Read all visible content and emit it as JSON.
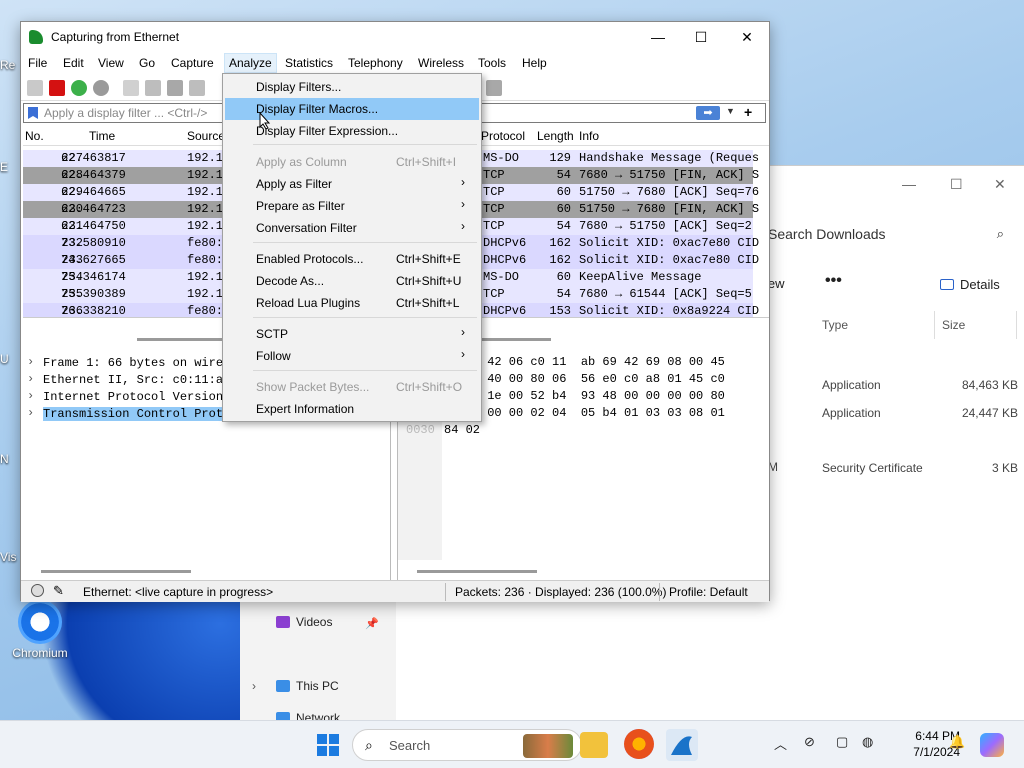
{
  "desktop": {
    "icon_chromium": "Chromium",
    "edge_fragments": [
      "Re",
      "E",
      "U",
      "N",
      "Vis"
    ]
  },
  "explorer": {
    "search_placeholder": "Search Downloads",
    "view_label": "iew",
    "more_label": "•••",
    "details_label": "Details",
    "col_type": "Type",
    "col_size": "Size",
    "rows": [
      {
        "type": "Application",
        "size": "84,463 KB"
      },
      {
        "type": "Application",
        "size": "24,447 KB"
      },
      {
        "type": "Security Certificate",
        "size": "3 KB"
      }
    ],
    "partial_m": "M",
    "nav": {
      "videos": "Videos",
      "this_pc": "This PC",
      "network": "Network"
    }
  },
  "wireshark": {
    "title": "Capturing from Ethernet",
    "menu": [
      "File",
      "Edit",
      "View",
      "Go",
      "Capture",
      "Analyze",
      "Statistics",
      "Telephony",
      "Wireless",
      "Tools",
      "Help"
    ],
    "filter_placeholder": "Apply a display filter ... <Ctrl-/>",
    "columns": {
      "no": "No.",
      "time": "Time",
      "source": "Source",
      "protocol": "Protocol",
      "length": "Length",
      "info": "Info"
    },
    "packets": [
      {
        "no": "227",
        "time": "62.463817",
        "src": "192.1",
        "proto": "MS-DO",
        "len": "129",
        "info": "Handshake Message (Reques"
      },
      {
        "no": "228",
        "time": "62.464379",
        "src": "192.1",
        "proto": "TCP",
        "len": "54",
        "info": "7680 → 51750 [FIN, ACK] S"
      },
      {
        "no": "229",
        "time": "62.464665",
        "src": "192.1",
        "proto": "TCP",
        "len": "60",
        "info": "51750 → 7680 [ACK] Seq=76"
      },
      {
        "no": "230",
        "time": "62.464723",
        "src": "192.1",
        "proto": "TCP",
        "len": "60",
        "info": "51750 → 7680 [FIN, ACK] S"
      },
      {
        "no": "231",
        "time": "62.464750",
        "src": "192.1",
        "proto": "TCP",
        "len": "54",
        "info": "7680 → 51750 [ACK] Seq=2"
      },
      {
        "no": "232",
        "time": "73.580910",
        "src": "fe80:",
        "proto": "DHCPv6",
        "len": "162",
        "info": "Solicit XID: 0xac7e80 CID"
      },
      {
        "no": "233",
        "time": "74.627665",
        "src": "fe80:",
        "proto": "DHCPv6",
        "len": "162",
        "info": "Solicit XID: 0xac7e80 CID"
      },
      {
        "no": "234",
        "time": "75.346174",
        "src": "192.1",
        "proto": "MS-DO",
        "len": "60",
        "info": "KeepAlive Message"
      },
      {
        "no": "235",
        "time": "75.390389",
        "src": "192.1",
        "proto": "TCP",
        "len": "54",
        "info": "7680 → 61544 [ACK] Seq=5"
      },
      {
        "no": "236",
        "time": "76.338210",
        "src": "fe80:",
        "proto": "DHCPv6",
        "len": "153",
        "info": "Solicit XID: 0x8a9224 CID"
      }
    ],
    "details": [
      "Frame 1: 66 bytes on wire",
      "Ethernet II, Src: c0:11:a",
      "Internet Protocol Version",
      "Transmission Control Prot"
    ],
    "hex": [
      "ab 69 42 06 c0 11  ab 69 42 69 08 00 45",
      "20 3e 40 00 80 06  56 e0 c0 a8 01 45 c0",
      "f0 97 1e 00 52 b4  93 48 00 00 00 00 80",
      "fb e4 00 00 02 04  05 b4 01 03 03 08 01",
      "84 02"
    ],
    "hex_offset_partial": "0030",
    "status": {
      "interface": "Ethernet: <live capture in progress>",
      "packets": "Packets: 236 · Displayed: 236 (100.0%)",
      "profile": "Profile: Default"
    }
  },
  "analyze_menu": {
    "items": [
      {
        "label": "Display Filters...",
        "shortcut": "",
        "submenu": false,
        "disabled": false,
        "highlighted": false
      },
      {
        "label": "Display Filter Macros...",
        "shortcut": "",
        "submenu": false,
        "disabled": false,
        "highlighted": true
      },
      {
        "label": "Display Filter Expression...",
        "shortcut": "",
        "submenu": false,
        "disabled": false,
        "highlighted": false
      },
      {
        "label": "Apply as Column",
        "shortcut": "Ctrl+Shift+I",
        "submenu": false,
        "disabled": true,
        "highlighted": false
      },
      {
        "label": "Apply as Filter",
        "shortcut": "",
        "submenu": true,
        "disabled": false,
        "highlighted": false
      },
      {
        "label": "Prepare as Filter",
        "shortcut": "",
        "submenu": true,
        "disabled": false,
        "highlighted": false
      },
      {
        "label": "Conversation Filter",
        "shortcut": "",
        "submenu": true,
        "disabled": false,
        "highlighted": false
      },
      {
        "label": "Enabled Protocols...",
        "shortcut": "Ctrl+Shift+E",
        "submenu": false,
        "disabled": false,
        "highlighted": false
      },
      {
        "label": "Decode As...",
        "shortcut": "Ctrl+Shift+U",
        "submenu": false,
        "disabled": false,
        "highlighted": false
      },
      {
        "label": "Reload Lua Plugins",
        "shortcut": "Ctrl+Shift+L",
        "submenu": false,
        "disabled": false,
        "highlighted": false
      },
      {
        "label": "SCTP",
        "shortcut": "",
        "submenu": true,
        "disabled": false,
        "highlighted": false
      },
      {
        "label": "Follow",
        "shortcut": "",
        "submenu": true,
        "disabled": false,
        "highlighted": false
      },
      {
        "label": "Show Packet Bytes...",
        "shortcut": "Ctrl+Shift+O",
        "submenu": false,
        "disabled": true,
        "highlighted": false
      },
      {
        "label": "Expert Information",
        "shortcut": "",
        "submenu": false,
        "disabled": false,
        "highlighted": false
      }
    ]
  },
  "taskbar": {
    "search_label": "Search",
    "time": "6:44 PM",
    "date": "7/1/2024"
  },
  "colors": {
    "menu_highlight": "#91c9f7",
    "row_light": "#e7e6ff",
    "row_gray": "#a0a0a0",
    "selected_detail": "#91c9f7"
  }
}
